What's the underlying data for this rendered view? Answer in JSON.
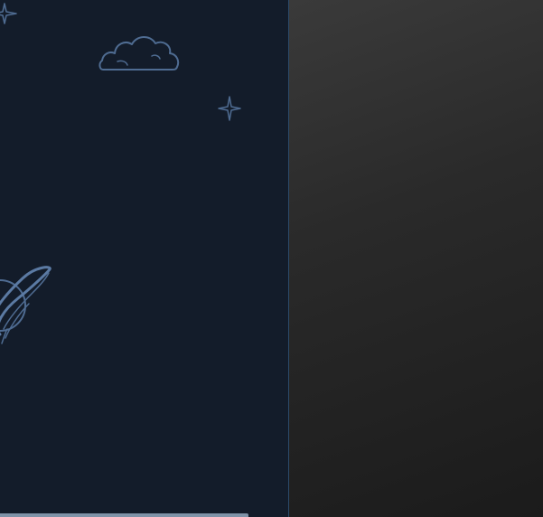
{
  "left_panel": {
    "background_color": "#131c2a",
    "doodle_color": "#4f6c92",
    "doodles": [
      "sparkle-icon",
      "cloud-icon",
      "sparkle-icon",
      "ringed-planet-icon"
    ],
    "bottom_bar_color": "#7f93a8"
  },
  "right_panel": {
    "gradient_start": "#3a3a3a",
    "gradient_end": "#1b1b1b"
  }
}
